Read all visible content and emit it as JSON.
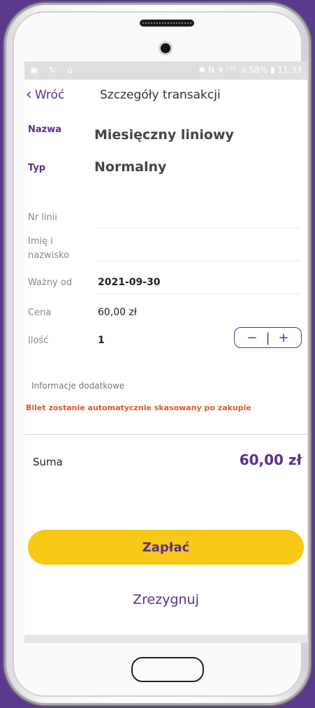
{
  "statusbar": {
    "left_icons": "▣ ↻ ⌂ ···",
    "right_text": "✱ N ✈ ᴸᵀᴱ .ıl 58% ▮ 11:33"
  },
  "header": {
    "back_label": "Wróć",
    "title": "Szczegóły transakcji"
  },
  "fields": {
    "nazwa_label": "Nazwa",
    "nazwa_value": "Miesięczny liniowy",
    "typ_label": "Typ",
    "typ_value": "Normalny",
    "nr_linii_label": "Nr linii",
    "imie_label_1": "Imię i",
    "imie_label_2": "nazwisko",
    "wazny_label": "Ważny od",
    "wazny_value": "2021-09-30",
    "cena_label": "Cena",
    "cena_value": "60,00 zł",
    "ilosc_label": "Ilość",
    "ilosc_value": "1"
  },
  "stepper": {
    "minus": "−",
    "divider": "|",
    "plus": "+"
  },
  "info": {
    "label": "Informacje dodatkowe",
    "text": "Bilet zostanie automatycznie skasowany po zakupie"
  },
  "summary": {
    "label": "Suma",
    "value": "60,00 zł"
  },
  "actions": {
    "pay_label": "Zapłać",
    "cancel_label": "Zrezygnuj"
  },
  "colors": {
    "accent": "#5c2d91",
    "button": "#f7c815",
    "warning": "#e2552a"
  }
}
